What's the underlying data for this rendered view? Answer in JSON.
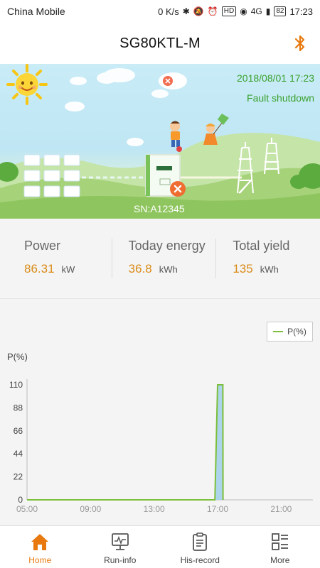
{
  "statusbar": {
    "carrier": "China Mobile",
    "speed": "0 K/s",
    "network": "4G",
    "hd": "HD",
    "battery": "82",
    "time": "17:23"
  },
  "header": {
    "title": "SG80KTL-M",
    "icon": "bluetooth-icon"
  },
  "scene": {
    "datetime": "2018/08/01 17:23",
    "status": "Fault shutdown",
    "sn": "SN:A12345"
  },
  "stats": [
    {
      "label": "Power",
      "value": "86.31",
      "unit": "kW"
    },
    {
      "label": "Today energy",
      "value": "36.8",
      "unit": "kWh"
    },
    {
      "label": "Total yield",
      "value": "135",
      "unit": "kWh"
    }
  ],
  "colors": {
    "accent": "#e8790e",
    "value": "#d98b17",
    "line": "#7cbf3a",
    "fill": "#a8d3ea",
    "status": "#3aa12e"
  },
  "chart_data": {
    "type": "area",
    "ylabel": "P(%)",
    "legend": [
      "P(%)"
    ],
    "legend_position": "top-right",
    "ylim": [
      0,
      110
    ],
    "yticks": [
      "110",
      "88",
      "66",
      "44",
      "22",
      "0"
    ],
    "xticks": [
      "05:00",
      "09:00",
      "13:00",
      "17:00",
      "21:00"
    ],
    "xlim_hours": [
      5,
      23
    ],
    "series": [
      {
        "name": "P(%)",
        "x": [
          5.0,
          16.83,
          17.0,
          17.33,
          17.34
        ],
        "y": [
          0,
          0,
          110,
          110,
          0
        ]
      }
    ],
    "grid": false
  },
  "tabs": [
    {
      "label": "Home",
      "icon": "home-icon",
      "active": true
    },
    {
      "label": "Run-info",
      "icon": "monitor-icon",
      "active": false
    },
    {
      "label": "His-record",
      "icon": "clipboard-icon",
      "active": false
    },
    {
      "label": "More",
      "icon": "grid-list-icon",
      "active": false
    }
  ]
}
